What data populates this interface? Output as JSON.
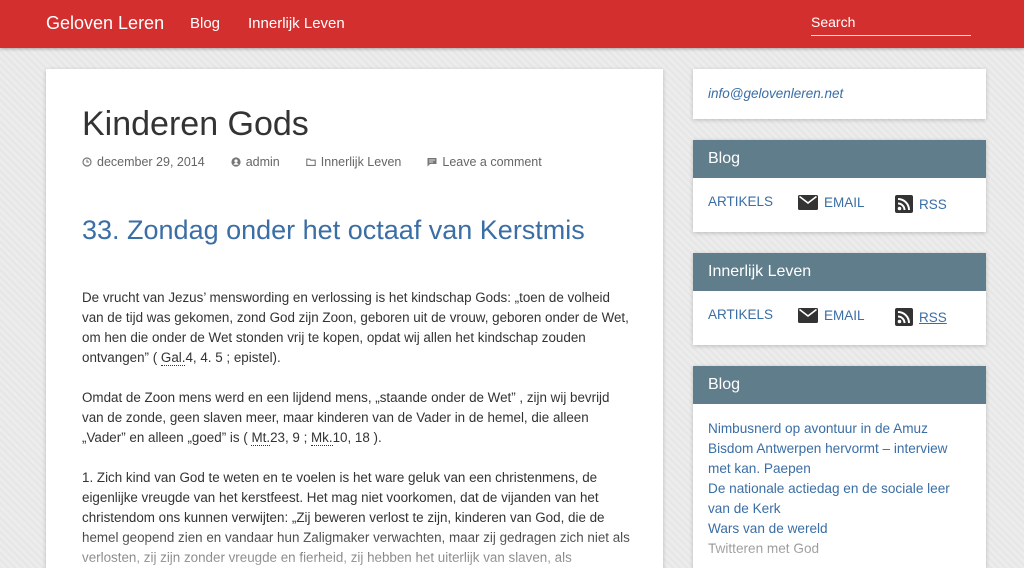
{
  "header": {
    "brand": "Geloven Leren",
    "nav": [
      "Blog",
      "Innerlijk Leven"
    ],
    "search_placeholder": "Search"
  },
  "post": {
    "title": "Kinderen Gods",
    "meta": {
      "date": "december 29, 2014",
      "author": "admin",
      "category": "Innerlijk Leven",
      "comment": "Leave a comment"
    },
    "heading": "33. Zondag onder het octaaf van Kerstmis",
    "paragraphs": [
      {
        "before": "De vrucht van Jezus’ menswording en verlossing is het kindschap Gods: „toen de volheid van de tijd was gekomen, zond God zijn Zoon, geboren uit de vrouw, geboren onder de Wet, om hen die onder de Wet stonden vrij te kopen, opdat wij allen het kindschap zouden ontvangen” ( ",
        "ref1": "Gal.",
        "mid": "4, 4. 5 ; epistel)."
      },
      {
        "before": "Omdat de Zoon mens werd en een lijdend mens, „staande onder de Wet” , zijn wij bevrijd van de zonde, geen slaven meer, maar kinderen van de Vader in de hemel, die alleen „Vader” en alleen „goed” is ( ",
        "ref1": "Mt.",
        "mid": "23, 9 ; ",
        "ref2": "Mk.",
        "after": "10, 18 )."
      },
      {
        "text": "1. Zich kind van God te weten en te voelen is het ware geluk van een christenmens, de eigenlijke vreugde van het kerstfeest. Het mag niet voorkomen, dat de vijanden van het christendom ons kunnen verwijten: „Zij beweren verlost te zijn, kinderen van God, die de hemel geopend zien en vandaar hun Zaligmaker verwachten, maar zij gedragen zich niet als verlosten, zij zijn zonder vreugde en fierheid, zij hebben het uiterlijk van slaven, als"
      }
    ]
  },
  "sidebar": {
    "email": "info@gelovenleren.net",
    "feed_widgets": [
      {
        "title": "Blog",
        "articles": "ARTIKELS",
        "email": "EMAIL",
        "rss": "RSS"
      },
      {
        "title": "Innerlijk Leven",
        "articles": "ARTIKELS",
        "email": "EMAIL",
        "rss": "RSS"
      }
    ],
    "recent": {
      "title": "Blog",
      "items": [
        "Nimbusnerd op avontuur in de Amuz",
        "Bisdom Antwerpen hervormt – interview met kan. Paepen",
        "De nationale actiedag en de sociale leer van de Kerk",
        "Wars van de wereld",
        "Twitteren met God"
      ]
    }
  },
  "colors": {
    "header_bg": "#d32f2f",
    "widget_header_bg": "#607d8b",
    "link": "#3a6ea5"
  }
}
